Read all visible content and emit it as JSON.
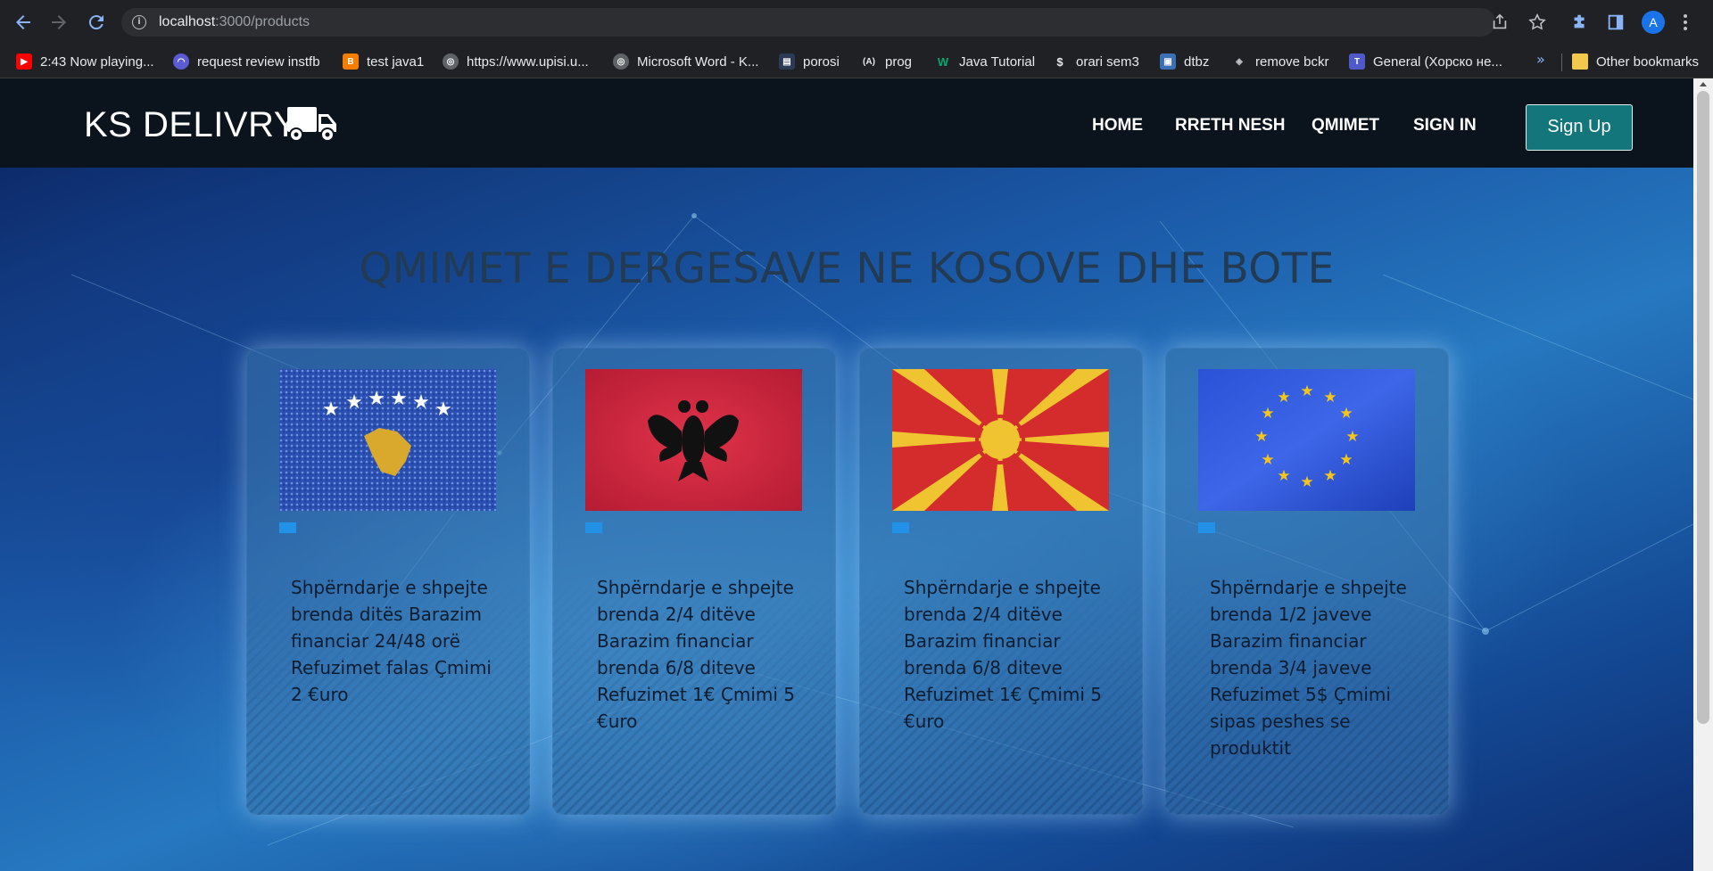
{
  "browser": {
    "url_host": "localhost",
    "url_path": ":3000/products",
    "profile_initial": "A",
    "bookmarks": [
      {
        "label": "2:43 Now playing...",
        "icon": "youtube-icon"
      },
      {
        "label": "request review instfb",
        "icon": "app-icon"
      },
      {
        "label": "test java1",
        "icon": "blogger-icon"
      },
      {
        "label": "https://www.upisi.u...",
        "icon": "globe-icon"
      },
      {
        "label": "Microsoft Word - K...",
        "icon": "globe-icon"
      },
      {
        "label": "porosi",
        "icon": "page-icon"
      },
      {
        "label": "prog",
        "icon": "angular-icon"
      },
      {
        "label": "Java Tutorial",
        "icon": "w3-icon"
      },
      {
        "label": "orari sem3",
        "icon": "dollar-icon"
      },
      {
        "label": "dtbz",
        "icon": "image-icon"
      },
      {
        "label": "remove bckr",
        "icon": "layers-icon"
      },
      {
        "label": "General (Хорско не...",
        "icon": "teams-icon"
      }
    ],
    "more_bookmarks": "»",
    "other_bookmarks": "Other bookmarks"
  },
  "header": {
    "brand": "KS DELIVRY",
    "nav": [
      "HOME",
      "RRETH NESH",
      "QMIMET",
      "SIGN IN"
    ],
    "signup_label": "Sign Up"
  },
  "hero": {
    "title": "QMIMET E DERGESAVE NE KOSOVE DHE BOTE"
  },
  "cards": [
    {
      "flag": "kosovo-flag",
      "text": "Shpërndarje e shpejte brenda ditës Barazim financiar 24/48 orë Refuzimet falas Çmimi 2 €uro"
    },
    {
      "flag": "albania-flag",
      "text": "Shpërndarje e shpejte brenda 2/4 ditëve Barazim financiar brenda 6/8 diteve Refuzimet 1€ Çmimi 5 €uro"
    },
    {
      "flag": "north-macedonia-flag",
      "text": "Shpërndarje e shpejte brenda 2/4 ditëve Barazim financiar brenda 6/8 diteve Refuzimet 1€ Çmimi 5 €uro"
    },
    {
      "flag": "eu-flag",
      "text": "Shpërndarje e shpejte brenda 1/2 javeve Barazim financiar brenda 3/4 javeve Refuzimet 5$ Çmimi sipas peshes se produktit"
    }
  ],
  "colors": {
    "header_bg": "#0b131d",
    "signup_bg": "#13767a",
    "title_color": "#233a53",
    "tag_color": "#2292e8"
  }
}
